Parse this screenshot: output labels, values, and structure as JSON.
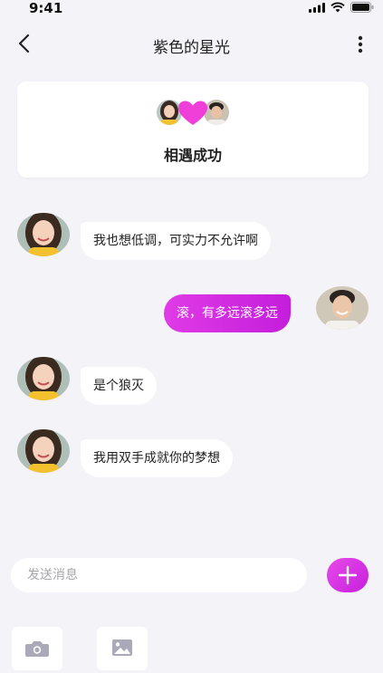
{
  "status_bar": {
    "time": "9:41",
    "icons": [
      "signal-icon",
      "wifi-icon",
      "battery-icon"
    ]
  },
  "nav": {
    "title": "紫色的星光",
    "back_icon": "chevron-left-icon",
    "more_icon": "more-vertical-icon"
  },
  "match_card": {
    "text": "相遇成功",
    "heart_color": "#f03fd8"
  },
  "messages": [
    {
      "side": "in",
      "text": "我也想低调，可实力不允许啊"
    },
    {
      "side": "out",
      "text": "滚，有多远滚多远"
    },
    {
      "side": "in",
      "text": "是个狼灭"
    },
    {
      "side": "in",
      "text": "我用双手成就你的梦想"
    }
  ],
  "composer": {
    "placeholder": "发送消息",
    "value": "",
    "plus_icon": "plus-icon"
  },
  "toolbar": {
    "camera_icon": "camera-icon",
    "image_icon": "image-icon"
  },
  "colors": {
    "accent": "#d42ae0",
    "background": "#f4f3f8",
    "bubble_in": "#ffffff"
  }
}
